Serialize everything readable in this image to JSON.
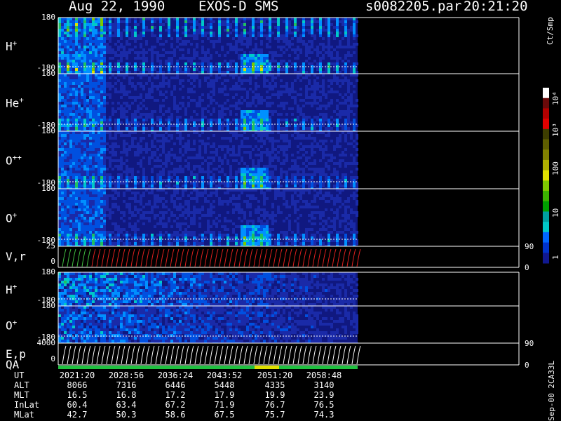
{
  "header": {
    "date": "Aug 22, 1990",
    "instrument": "EXOS-D SMS",
    "file": "s0082205.par",
    "time": "20:21:20"
  },
  "colorbar": {
    "label": "Ct/Smp",
    "ticks": [
      "10⁴",
      "10³",
      "100",
      "10",
      "1"
    ],
    "colors": [
      "#ffffff",
      "#6b0a0a",
      "#b30000",
      "#e00000",
      "#3d3d00",
      "#5e5e00",
      "#808000",
      "#b0b000",
      "#e0e000",
      "#7ec800",
      "#3cb400",
      "#00a000",
      "#00a0a0",
      "#00c8c8",
      "#0066ff",
      "#0033cc",
      "#101890"
    ]
  },
  "side_id": "Sep-00  2CA33L",
  "chart_data": {
    "type": "heatmap",
    "panels": [
      {
        "label": "H",
        "sup": "+",
        "ymax": "180",
        "ymin": "-180",
        "kind": "pitch",
        "intensity": 0.9
      },
      {
        "label": "He",
        "sup": "+",
        "ymax": "180",
        "ymin": "-180",
        "kind": "pitch",
        "intensity": 0.55
      },
      {
        "label": "O",
        "sup": "++",
        "ymax": "180",
        "ymin": "-180",
        "kind": "pitch",
        "intensity": 0.5
      },
      {
        "label": "O",
        "sup": "+",
        "ymax": "180",
        "ymin": "-180",
        "kind": "pitch",
        "intensity": 0.6
      },
      {
        "label": "V,r",
        "sup": "",
        "ymax": "25",
        "ymin": "0",
        "rtop": "90",
        "rbot": "0",
        "kind": "line-red"
      },
      {
        "label": "H",
        "sup": "+",
        "ymax": "180",
        "ymin": "-180",
        "kind": "pitch-low",
        "intensity": 0.8
      },
      {
        "label": "O",
        "sup": "+",
        "ymax": "180",
        "ymin": "-180",
        "kind": "pitch-low",
        "intensity": 0.6
      },
      {
        "label": "E,p",
        "sup": "",
        "ymax": "4000",
        "ymin": "0",
        "rtop": "90",
        "rbot": "0",
        "kind": "line-white"
      }
    ],
    "qa_label": "QA",
    "xaxis": {
      "rows": [
        {
          "label": "UT",
          "values": [
            "2021:20",
            "2028:56",
            "2036:24",
            "2043:52",
            "2051:20",
            "2058:48"
          ]
        },
        {
          "label": "ALT",
          "values": [
            "8066",
            "7316",
            "6446",
            "5448",
            "4335",
            "3140"
          ]
        },
        {
          "label": "MLT",
          "values": [
            "16.5",
            "16.8",
            "17.2",
            "17.9",
            "19.9",
            "23.9"
          ]
        },
        {
          "label": "InLat",
          "values": [
            "60.4",
            "63.4",
            "67.2",
            "71.9",
            "76.7",
            "76.5"
          ]
        },
        {
          "label": "MLat",
          "values": [
            "42.7",
            "50.3",
            "58.6",
            "67.5",
            "75.7",
            "74.3"
          ]
        }
      ]
    }
  }
}
